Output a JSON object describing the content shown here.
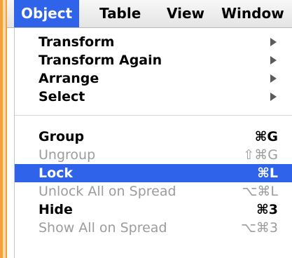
{
  "menubar": {
    "items": [
      {
        "label": "Object",
        "active": true
      },
      {
        "label": "Table",
        "active": false
      },
      {
        "label": "View",
        "active": false
      },
      {
        "label": "Window",
        "active": false
      }
    ]
  },
  "menu": {
    "items": [
      {
        "label": "Transform",
        "submenu": true
      },
      {
        "label": "Transform Again",
        "submenu": true
      },
      {
        "label": "Arrange",
        "submenu": true
      },
      {
        "label": "Select",
        "submenu": true
      },
      {
        "label": "Group",
        "shortcut": "⌘G",
        "enabled": true
      },
      {
        "label": "Ungroup",
        "shortcut": "⇧⌘G",
        "enabled": false
      },
      {
        "label": "Lock",
        "shortcut": "⌘L",
        "enabled": true,
        "highlighted": true
      },
      {
        "label": "Unlock All on Spread",
        "shortcut": "⌥⌘L",
        "enabled": false
      },
      {
        "label": "Hide",
        "shortcut": "⌘3",
        "enabled": true
      },
      {
        "label": "Show All on Spread",
        "shortcut": "⌥⌘3",
        "enabled": false
      }
    ]
  },
  "colors": {
    "highlight": "#2f63ea",
    "disabled_text": "#9c9c9c",
    "submenu_arrow": "#5b5b5b"
  }
}
